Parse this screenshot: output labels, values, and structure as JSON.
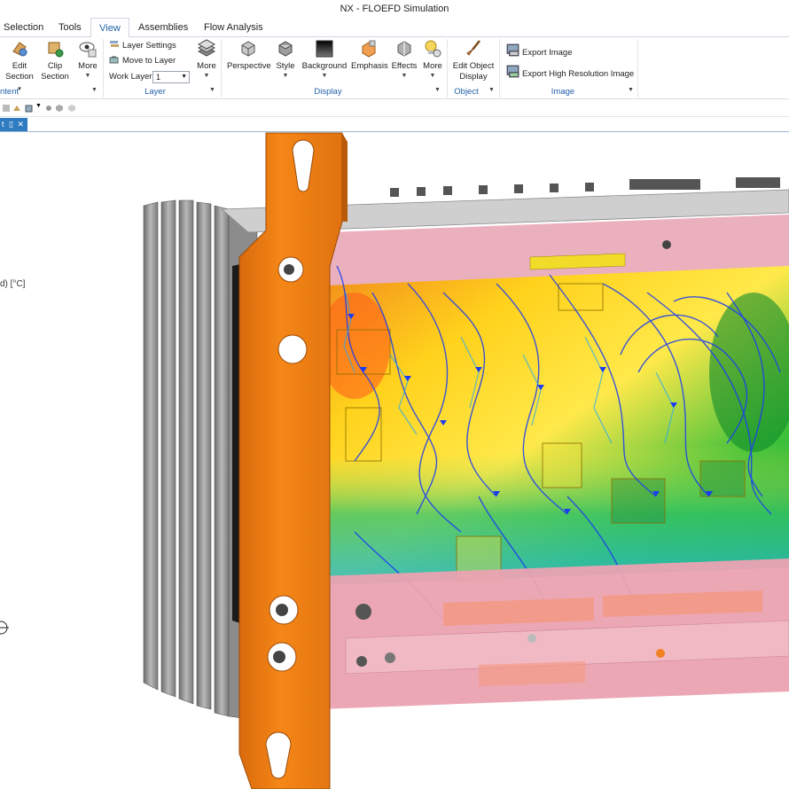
{
  "window": {
    "title": "NX - FLOEFD Simulation"
  },
  "menu": {
    "tabs": [
      {
        "label": "Selection",
        "active": false
      },
      {
        "label": "Tools",
        "active": false
      },
      {
        "label": "View",
        "active": true
      },
      {
        "label": "Assemblies",
        "active": false
      },
      {
        "label": "Flow Analysis",
        "active": false
      }
    ]
  },
  "ribbon": {
    "edit_section": {
      "line1": "Edit",
      "line2": "Section"
    },
    "clip_section": {
      "line1": "Clip",
      "line2": "Section"
    },
    "more_content": "More",
    "content_group": "ntent",
    "layer_settings": "Layer Settings",
    "move_to_layer": "Move to Layer",
    "work_layer_label": "Work Layer",
    "work_layer_value": "1",
    "more_layer": "More",
    "layer_group": "Layer",
    "perspective": "Perspective",
    "style": "Style",
    "background": "Background",
    "emphasis": "Emphasis",
    "effects": "Effects",
    "more_display": "More",
    "display_group": "Display",
    "edit_object_display": {
      "line1": "Edit Object",
      "line2": "Display"
    },
    "object_group": "Object",
    "export_image": "Export Image",
    "export_high_res": "Export High Resolution Image",
    "image_group": "Image"
  },
  "doc_tab": {
    "label": "t"
  },
  "viewport": {
    "legend_partial_label": "d) [°C]",
    "scene": "FLOEFD simulation of electronics enclosure with temperature contour and flow trajectories"
  },
  "colors": {
    "accent": "#1f5fa8",
    "doc_tab": "#2e7bc0",
    "bracket": "#f07d13",
    "enclosure": "#e8a3b3"
  }
}
